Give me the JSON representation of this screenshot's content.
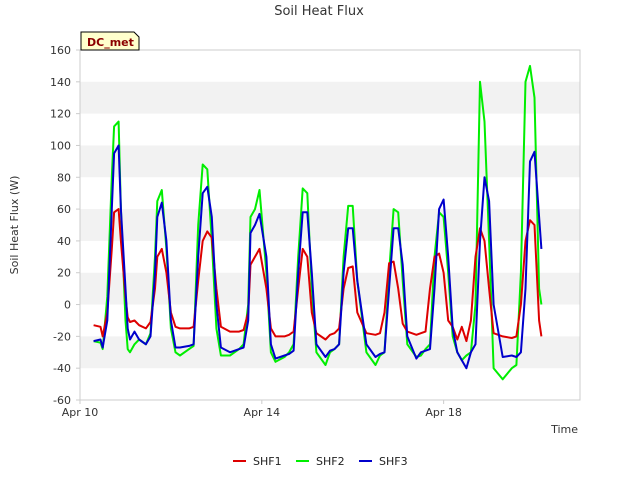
{
  "chart_data": {
    "type": "line",
    "title": "Soil Heat Flux",
    "xlabel": "Time",
    "ylabel": "Soil Heat Flux (W)",
    "ylim": [
      -60,
      160
    ],
    "yticks": [
      -60,
      -40,
      -20,
      0,
      20,
      40,
      60,
      80,
      100,
      120,
      140,
      160
    ],
    "xlim": [
      0,
      11
    ],
    "xtick_positions": [
      0,
      4,
      8
    ],
    "xtick_labels": [
      "Apr 10",
      "Apr 14",
      "Apr 18"
    ],
    "grid": "horizontal alternating bands",
    "legend_position": "bottom-center",
    "badge": "DC_met",
    "colors": {
      "SHF1": "#dd0000",
      "SHF2": "#00ee00",
      "SHF3": "#0000cc",
      "band": "#f2f2f2",
      "axis": "#cccccc",
      "badge_bg": "#ffffcc"
    },
    "series": [
      {
        "name": "SHF1",
        "x": [
          0.3,
          0.45,
          0.5,
          0.6,
          0.7,
          0.75,
          0.85,
          0.9,
          1.0,
          1.05,
          1.1,
          1.2,
          1.3,
          1.45,
          1.55,
          1.65,
          1.7,
          1.8,
          1.9,
          2.0,
          2.1,
          2.2,
          2.4,
          2.5,
          2.6,
          2.7,
          2.8,
          2.9,
          3.0,
          3.1,
          3.3,
          3.5,
          3.6,
          3.7,
          3.75,
          3.85,
          3.95,
          4.1,
          4.2,
          4.3,
          4.5,
          4.6,
          4.7,
          4.8,
          4.9,
          5.0,
          5.1,
          5.2,
          5.4,
          5.5,
          5.6,
          5.7,
          5.8,
          5.9,
          6.0,
          6.1,
          6.3,
          6.5,
          6.6,
          6.7,
          6.8,
          6.9,
          7.0,
          7.1,
          7.2,
          7.4,
          7.5,
          7.6,
          7.7,
          7.8,
          7.9,
          8.0,
          8.1,
          8.2,
          8.3,
          8.4,
          8.5,
          8.6,
          8.7,
          8.8,
          8.9,
          9.0,
          9.1,
          9.3,
          9.5,
          9.6,
          9.7,
          9.8,
          9.9,
          10.0,
          10.1,
          10.15
        ],
        "y": [
          -13,
          -14,
          -20,
          -5,
          35,
          58,
          60,
          40,
          5,
          -8,
          -11,
          -10,
          -13,
          -15,
          -11,
          10,
          30,
          35,
          20,
          -5,
          -14,
          -15,
          -15,
          -14,
          15,
          40,
          46,
          42,
          10,
          -14,
          -17,
          -17,
          -16,
          -5,
          25,
          30,
          35,
          10,
          -15,
          -20,
          -20,
          -19,
          -17,
          10,
          35,
          30,
          -5,
          -18,
          -22,
          -19,
          -18,
          -15,
          10,
          23,
          24,
          -5,
          -18,
          -19,
          -18,
          -5,
          26,
          27,
          10,
          -12,
          -17,
          -19,
          -18,
          -17,
          10,
          30,
          32,
          20,
          -10,
          -14,
          -22,
          -14,
          -23,
          -10,
          30,
          48,
          40,
          10,
          -18,
          -20,
          -21,
          -20,
          0,
          40,
          53,
          50,
          -10,
          -20
        ]
      },
      {
        "name": "SHF2",
        "x": [
          0.3,
          0.45,
          0.5,
          0.6,
          0.7,
          0.75,
          0.85,
          0.9,
          1.0,
          1.05,
          1.1,
          1.2,
          1.3,
          1.45,
          1.55,
          1.65,
          1.7,
          1.8,
          1.9,
          2.0,
          2.1,
          2.2,
          2.4,
          2.5,
          2.6,
          2.7,
          2.8,
          2.9,
          3.0,
          3.1,
          3.3,
          3.5,
          3.6,
          3.7,
          3.75,
          3.85,
          3.95,
          4.1,
          4.2,
          4.3,
          4.5,
          4.6,
          4.7,
          4.8,
          4.9,
          5.0,
          5.1,
          5.2,
          5.4,
          5.5,
          5.6,
          5.7,
          5.8,
          5.9,
          6.0,
          6.1,
          6.3,
          6.5,
          6.6,
          6.7,
          6.8,
          6.9,
          7.0,
          7.1,
          7.2,
          7.4,
          7.5,
          7.6,
          7.7,
          7.8,
          7.9,
          8.0,
          8.1,
          8.2,
          8.3,
          8.4,
          8.5,
          8.6,
          8.7,
          8.8,
          8.9,
          9.0,
          9.1,
          9.3,
          9.5,
          9.6,
          9.7,
          9.8,
          9.9,
          10.0,
          10.1,
          10.15
        ],
        "y": [
          -23,
          -24,
          -28,
          5,
          80,
          112,
          115,
          60,
          -10,
          -28,
          -30,
          -25,
          -22,
          -25,
          -18,
          30,
          65,
          72,
          35,
          -15,
          -30,
          -32,
          -28,
          -26,
          50,
          88,
          85,
          40,
          -15,
          -32,
          -32,
          -28,
          -25,
          0,
          55,
          60,
          72,
          20,
          -30,
          -36,
          -33,
          -30,
          -25,
          30,
          73,
          70,
          10,
          -30,
          -38,
          -30,
          -28,
          -25,
          30,
          62,
          62,
          15,
          -30,
          -38,
          -32,
          -30,
          20,
          60,
          58,
          15,
          -25,
          -33,
          -32,
          -28,
          -25,
          30,
          58,
          55,
          20,
          -20,
          -30,
          -35,
          -32,
          -30,
          0,
          140,
          115,
          40,
          -40,
          -47,
          -40,
          -38,
          20,
          140,
          150,
          130,
          10,
          0
        ]
      },
      {
        "name": "SHF3",
        "x": [
          0.3,
          0.45,
          0.5,
          0.6,
          0.7,
          0.75,
          0.85,
          0.9,
          1.0,
          1.05,
          1.1,
          1.2,
          1.3,
          1.45,
          1.55,
          1.65,
          1.7,
          1.8,
          1.9,
          2.0,
          2.1,
          2.2,
          2.4,
          2.5,
          2.6,
          2.7,
          2.8,
          2.9,
          3.0,
          3.1,
          3.3,
          3.5,
          3.6,
          3.7,
          3.75,
          3.85,
          3.95,
          4.1,
          4.2,
          4.3,
          4.5,
          4.6,
          4.7,
          4.8,
          4.9,
          5.0,
          5.1,
          5.2,
          5.4,
          5.5,
          5.6,
          5.7,
          5.8,
          5.9,
          6.0,
          6.1,
          6.3,
          6.5,
          6.6,
          6.7,
          6.8,
          6.9,
          7.0,
          7.1,
          7.2,
          7.4,
          7.5,
          7.6,
          7.7,
          7.8,
          7.9,
          8.0,
          8.1,
          8.2,
          8.3,
          8.4,
          8.5,
          8.6,
          8.7,
          8.8,
          8.9,
          9.0,
          9.1,
          9.3,
          9.5,
          9.6,
          9.7,
          9.8,
          9.9,
          10.0,
          10.1,
          10.15
        ],
        "y": [
          -23,
          -22,
          -27,
          -10,
          60,
          95,
          100,
          60,
          10,
          -15,
          -22,
          -17,
          -22,
          -25,
          -20,
          20,
          55,
          64,
          40,
          -10,
          -27,
          -27,
          -26,
          -25,
          30,
          70,
          74,
          55,
          0,
          -27,
          -30,
          -28,
          -27,
          -10,
          45,
          50,
          57,
          30,
          -25,
          -34,
          -32,
          -31,
          -29,
          20,
          58,
          58,
          20,
          -25,
          -33,
          -29,
          -28,
          -25,
          20,
          48,
          48,
          15,
          -25,
          -33,
          -31,
          -30,
          10,
          48,
          48,
          25,
          -20,
          -34,
          -30,
          -29,
          -28,
          10,
          60,
          66,
          30,
          -15,
          -30,
          -35,
          -40,
          -30,
          -25,
          40,
          80,
          65,
          0,
          -33,
          -32,
          -33,
          -30,
          10,
          90,
          96,
          55,
          35
        ]
      }
    ]
  }
}
